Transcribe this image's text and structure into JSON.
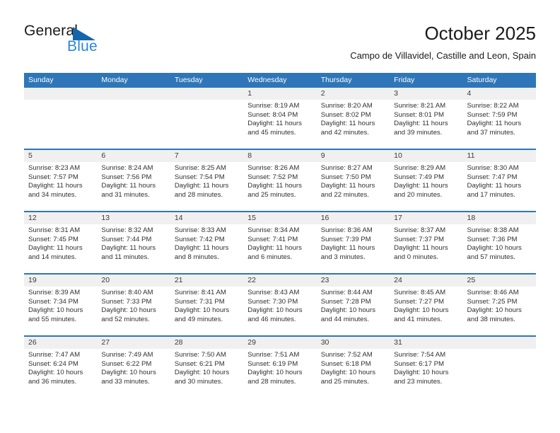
{
  "logo": {
    "word_top": "General",
    "word_bottom": "Blue",
    "triangle_color": "#1366ac",
    "blue_color": "#2a86d6"
  },
  "header": {
    "title": "October 2025",
    "subtitle": "Campo de Villavidel, Castille and Leon, Spain"
  },
  "colors": {
    "header_blue": "#2e76b8",
    "day_strip_gray": "#f0f0f0",
    "text": "#303030"
  },
  "weekdays": [
    "Sunday",
    "Monday",
    "Tuesday",
    "Wednesday",
    "Thursday",
    "Friday",
    "Saturday"
  ],
  "weeks": [
    [
      {
        "day": "",
        "sunrise": "",
        "sunset": "",
        "daylight": ""
      },
      {
        "day": "",
        "sunrise": "",
        "sunset": "",
        "daylight": ""
      },
      {
        "day": "",
        "sunrise": "",
        "sunset": "",
        "daylight": ""
      },
      {
        "day": "1",
        "sunrise": "Sunrise: 8:19 AM",
        "sunset": "Sunset: 8:04 PM",
        "daylight": "Daylight: 11 hours and 45 minutes."
      },
      {
        "day": "2",
        "sunrise": "Sunrise: 8:20 AM",
        "sunset": "Sunset: 8:02 PM",
        "daylight": "Daylight: 11 hours and 42 minutes."
      },
      {
        "day": "3",
        "sunrise": "Sunrise: 8:21 AM",
        "sunset": "Sunset: 8:01 PM",
        "daylight": "Daylight: 11 hours and 39 minutes."
      },
      {
        "day": "4",
        "sunrise": "Sunrise: 8:22 AM",
        "sunset": "Sunset: 7:59 PM",
        "daylight": "Daylight: 11 hours and 37 minutes."
      }
    ],
    [
      {
        "day": "5",
        "sunrise": "Sunrise: 8:23 AM",
        "sunset": "Sunset: 7:57 PM",
        "daylight": "Daylight: 11 hours and 34 minutes."
      },
      {
        "day": "6",
        "sunrise": "Sunrise: 8:24 AM",
        "sunset": "Sunset: 7:56 PM",
        "daylight": "Daylight: 11 hours and 31 minutes."
      },
      {
        "day": "7",
        "sunrise": "Sunrise: 8:25 AM",
        "sunset": "Sunset: 7:54 PM",
        "daylight": "Daylight: 11 hours and 28 minutes."
      },
      {
        "day": "8",
        "sunrise": "Sunrise: 8:26 AM",
        "sunset": "Sunset: 7:52 PM",
        "daylight": "Daylight: 11 hours and 25 minutes."
      },
      {
        "day": "9",
        "sunrise": "Sunrise: 8:27 AM",
        "sunset": "Sunset: 7:50 PM",
        "daylight": "Daylight: 11 hours and 22 minutes."
      },
      {
        "day": "10",
        "sunrise": "Sunrise: 8:29 AM",
        "sunset": "Sunset: 7:49 PM",
        "daylight": "Daylight: 11 hours and 20 minutes."
      },
      {
        "day": "11",
        "sunrise": "Sunrise: 8:30 AM",
        "sunset": "Sunset: 7:47 PM",
        "daylight": "Daylight: 11 hours and 17 minutes."
      }
    ],
    [
      {
        "day": "12",
        "sunrise": "Sunrise: 8:31 AM",
        "sunset": "Sunset: 7:45 PM",
        "daylight": "Daylight: 11 hours and 14 minutes."
      },
      {
        "day": "13",
        "sunrise": "Sunrise: 8:32 AM",
        "sunset": "Sunset: 7:44 PM",
        "daylight": "Daylight: 11 hours and 11 minutes."
      },
      {
        "day": "14",
        "sunrise": "Sunrise: 8:33 AM",
        "sunset": "Sunset: 7:42 PM",
        "daylight": "Daylight: 11 hours and 8 minutes."
      },
      {
        "day": "15",
        "sunrise": "Sunrise: 8:34 AM",
        "sunset": "Sunset: 7:41 PM",
        "daylight": "Daylight: 11 hours and 6 minutes."
      },
      {
        "day": "16",
        "sunrise": "Sunrise: 8:36 AM",
        "sunset": "Sunset: 7:39 PM",
        "daylight": "Daylight: 11 hours and 3 minutes."
      },
      {
        "day": "17",
        "sunrise": "Sunrise: 8:37 AM",
        "sunset": "Sunset: 7:37 PM",
        "daylight": "Daylight: 11 hours and 0 minutes."
      },
      {
        "day": "18",
        "sunrise": "Sunrise: 8:38 AM",
        "sunset": "Sunset: 7:36 PM",
        "daylight": "Daylight: 10 hours and 57 minutes."
      }
    ],
    [
      {
        "day": "19",
        "sunrise": "Sunrise: 8:39 AM",
        "sunset": "Sunset: 7:34 PM",
        "daylight": "Daylight: 10 hours and 55 minutes."
      },
      {
        "day": "20",
        "sunrise": "Sunrise: 8:40 AM",
        "sunset": "Sunset: 7:33 PM",
        "daylight": "Daylight: 10 hours and 52 minutes."
      },
      {
        "day": "21",
        "sunrise": "Sunrise: 8:41 AM",
        "sunset": "Sunset: 7:31 PM",
        "daylight": "Daylight: 10 hours and 49 minutes."
      },
      {
        "day": "22",
        "sunrise": "Sunrise: 8:43 AM",
        "sunset": "Sunset: 7:30 PM",
        "daylight": "Daylight: 10 hours and 46 minutes."
      },
      {
        "day": "23",
        "sunrise": "Sunrise: 8:44 AM",
        "sunset": "Sunset: 7:28 PM",
        "daylight": "Daylight: 10 hours and 44 minutes."
      },
      {
        "day": "24",
        "sunrise": "Sunrise: 8:45 AM",
        "sunset": "Sunset: 7:27 PM",
        "daylight": "Daylight: 10 hours and 41 minutes."
      },
      {
        "day": "25",
        "sunrise": "Sunrise: 8:46 AM",
        "sunset": "Sunset: 7:25 PM",
        "daylight": "Daylight: 10 hours and 38 minutes."
      }
    ],
    [
      {
        "day": "26",
        "sunrise": "Sunrise: 7:47 AM",
        "sunset": "Sunset: 6:24 PM",
        "daylight": "Daylight: 10 hours and 36 minutes."
      },
      {
        "day": "27",
        "sunrise": "Sunrise: 7:49 AM",
        "sunset": "Sunset: 6:22 PM",
        "daylight": "Daylight: 10 hours and 33 minutes."
      },
      {
        "day": "28",
        "sunrise": "Sunrise: 7:50 AM",
        "sunset": "Sunset: 6:21 PM",
        "daylight": "Daylight: 10 hours and 30 minutes."
      },
      {
        "day": "29",
        "sunrise": "Sunrise: 7:51 AM",
        "sunset": "Sunset: 6:19 PM",
        "daylight": "Daylight: 10 hours and 28 minutes."
      },
      {
        "day": "30",
        "sunrise": "Sunrise: 7:52 AM",
        "sunset": "Sunset: 6:18 PM",
        "daylight": "Daylight: 10 hours and 25 minutes."
      },
      {
        "day": "31",
        "sunrise": "Sunrise: 7:54 AM",
        "sunset": "Sunset: 6:17 PM",
        "daylight": "Daylight: 10 hours and 23 minutes."
      },
      {
        "day": "",
        "sunrise": "",
        "sunset": "",
        "daylight": ""
      }
    ]
  ]
}
